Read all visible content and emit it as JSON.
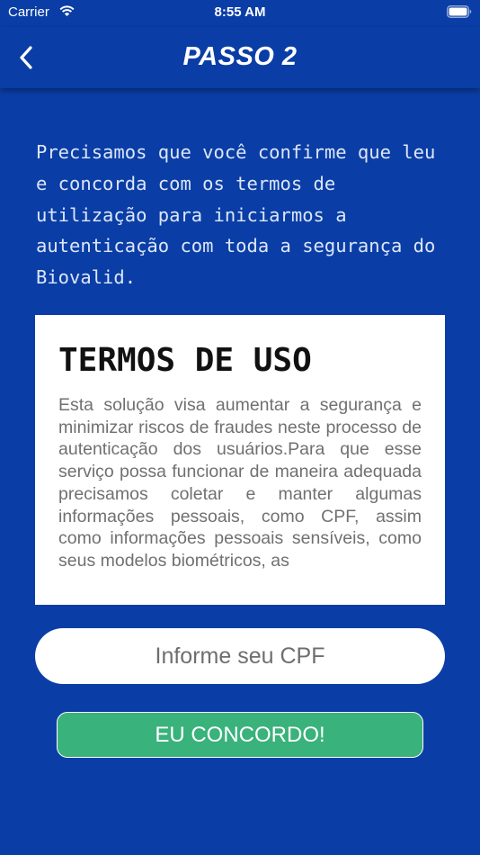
{
  "status_bar": {
    "carrier": "Carrier",
    "time": "8:55 AM"
  },
  "nav": {
    "title": "PASSO 2",
    "back_icon": "chevron-left-icon"
  },
  "intro": {
    "text": "Precisamos que você confirme que leu e concorda com os termos de utilização para iniciarmos a autenticação com toda a segurança do Biovalid."
  },
  "terms": {
    "title": "TERMOS DE USO",
    "body": "Esta solução visa aumentar a segurança e minimizar riscos de fraudes neste processo de autenticação dos usuários.Para que esse serviço possa funcionar de maneira adequada precisamos coletar e manter algumas informações pessoais, como CPF, assim como informações pessoais sensíveis, como seus modelos biométricos, as"
  },
  "cpf_input": {
    "placeholder": "Informe seu CPF",
    "value": ""
  },
  "agree_button": {
    "label": "EU CONCORDO!"
  },
  "colors": {
    "background": "#0a3ea6",
    "button_green": "#39b27b",
    "card": "#ffffff"
  }
}
